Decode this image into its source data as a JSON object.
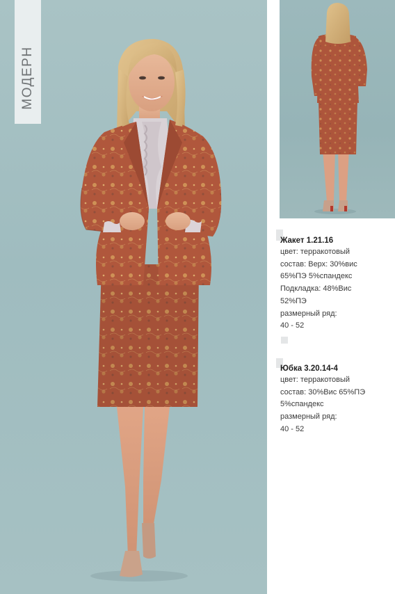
{
  "collection": {
    "label": "МОДЕРН"
  },
  "colors": {
    "suit": "#b25a3f",
    "background": "#a5c1c3",
    "blouse": "#d9d2d6"
  },
  "products": [
    {
      "title": "Жакет 1.21.16",
      "lines": [
        "цвет: терракотовый",
        "состав: Верх: 30%вис",
        "65%ПЭ 5%спандекс",
        "Подкладка: 48%Вис",
        "52%ПЭ",
        "размерный ряд:",
        "40 - 52"
      ]
    },
    {
      "title": "Юбка 3.20.14-4",
      "lines": [
        "цвет: терракотовый",
        "состав: 30%Вис 65%ПЭ",
        "5%спандекс",
        "размерный ряд:",
        "40 - 52"
      ]
    }
  ]
}
